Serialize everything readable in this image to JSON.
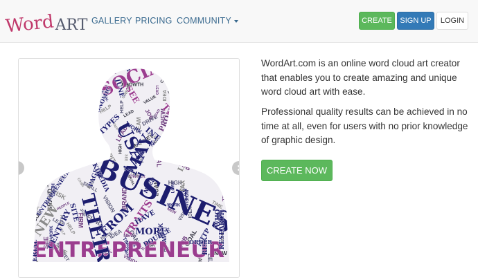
{
  "brand": {
    "logo_word": "Word",
    "logo_art": "ART"
  },
  "nav": {
    "gallery": "GALLERY",
    "pricing": "PRICING",
    "community": "COMMUNITY"
  },
  "header_buttons": {
    "create": "CREATE",
    "signup": "SIGN UP",
    "login": "LOGIN"
  },
  "hero": {
    "description": "WordArt.com is an online word cloud art creator that enables you to create amazing and unique word cloud art with ease.",
    "subtext": "Professional quality results can be achieved in no time at all, even for users with no prior knowledge of graphic design.",
    "cta": "CREATE NOW"
  },
  "word_cloud": {
    "colors": {
      "navy": "#1d1d6e",
      "magenta": "#9b3d8f",
      "purple": "#6b3a7c",
      "gray": "#8a8a8a",
      "dark": "#333340",
      "slate": "#5a5a78"
    },
    "words": [
      {
        "text": "ENTREPRENEUR",
        "color": "magenta"
      },
      {
        "text": "BUSINESS",
        "color": "navy"
      },
      {
        "text": "SOCIAL",
        "color": "magenta"
      },
      {
        "text": "USA",
        "color": "navy"
      },
      {
        "text": "THEIR",
        "color": "navy"
      },
      {
        "text": "MAY",
        "color": "navy"
      },
      {
        "text": "NEW",
        "color": "gray"
      },
      {
        "text": "FROM",
        "color": "navy"
      },
      {
        "text": "INTERNET",
        "color": "navy"
      },
      {
        "text": "LIFESTYLE",
        "color": "gray"
      },
      {
        "text": "TRAITS",
        "color": "magenta"
      },
      {
        "text": "MORE",
        "color": "navy"
      },
      {
        "text": "TYPES",
        "color": "navy"
      },
      {
        "text": "PROFIT",
        "color": "purple"
      },
      {
        "text": "CENTURY",
        "color": "navy"
      },
      {
        "text": "SERIAL",
        "color": "navy"
      },
      {
        "text": "ECONOMIC",
        "color": "navy"
      },
      {
        "text": "RISK",
        "color": "navy"
      },
      {
        "text": "RESEARCH",
        "color": "navy"
      },
      {
        "text": "HTTP",
        "color": "navy"
      },
      {
        "text": "ORDER",
        "color": "navy"
      },
      {
        "text": "PAGE",
        "color": "navy"
      },
      {
        "text": "WHO",
        "color": "navy"
      },
      {
        "text": "HAVE",
        "color": "navy"
      },
      {
        "text": "THERE",
        "color": "magenta"
      },
      {
        "text": "JUNE",
        "color": "navy"
      },
      {
        "text": "SITE",
        "color": "navy"
      },
      {
        "text": "SEE",
        "color": "magenta"
      },
      {
        "text": "DOUBLE",
        "color": "navy"
      },
      {
        "text": "WIKIPEDIA",
        "color": "navy"
      },
      {
        "text": "ENTREPRENEURIAL",
        "color": "navy"
      }
    ]
  }
}
